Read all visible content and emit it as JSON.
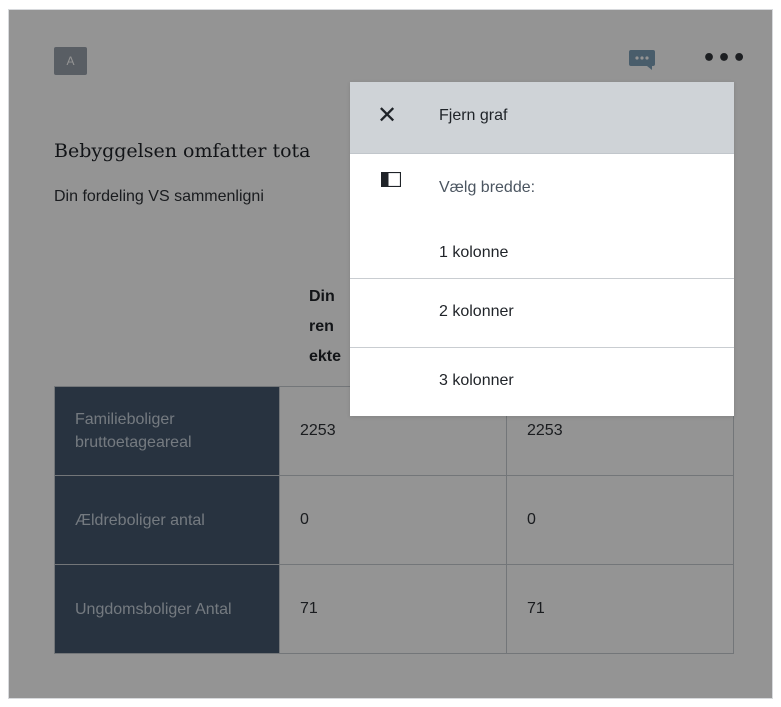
{
  "header": {
    "avatar_text": "A",
    "comment_icon": "comment-icon",
    "more_icon": "more-icon",
    "more_glyph": "•••"
  },
  "widget": {
    "title": "Bebyggelsen omfatter tota",
    "subtitle": "Din fordeling VS sammenligni",
    "column_header_partial": [
      "Din",
      "ren",
      "ekte"
    ],
    "rows": [
      {
        "label": "Familieboliger bruttoetageareal",
        "col1": "2253",
        "col2": "2253"
      },
      {
        "label": "Ældreboliger antal",
        "col1": "0",
        "col2": "0"
      },
      {
        "label": "Ungdomsboliger Antal",
        "col1": "71",
        "col2": "71"
      }
    ]
  },
  "menu": {
    "remove_label": "Fjern graf",
    "remove_icon": "close-icon",
    "width_label": "Vælg bredde:",
    "width_icon": "column-width-icon",
    "options": [
      "1 kolonne",
      "2 kolonner",
      "3 kolonner"
    ]
  },
  "colors": {
    "row_header_bg": "#46596f",
    "overlay": "rgba(0,0,0,0.42)",
    "menu_highlight": "#cfd3d7"
  }
}
